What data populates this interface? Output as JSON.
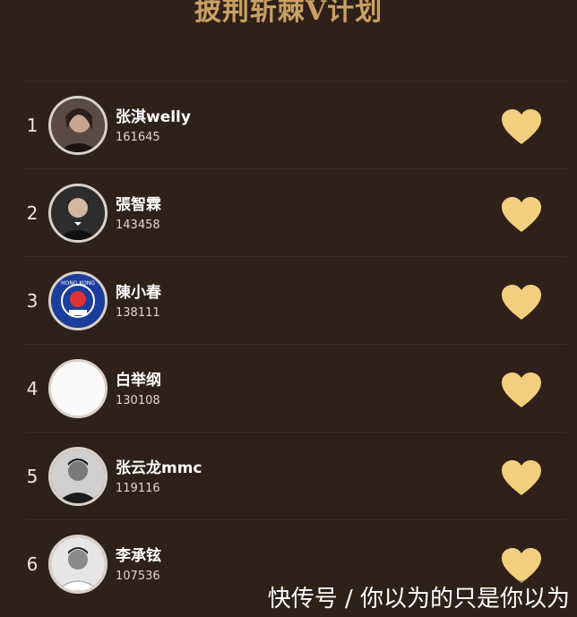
{
  "header": {
    "title": "披荆斩棘V计划"
  },
  "ranking": [
    {
      "rank": "1",
      "name": "张淇welly",
      "score": "161645"
    },
    {
      "rank": "2",
      "name": "張智霖",
      "score": "143458"
    },
    {
      "rank": "3",
      "name": "陳小春",
      "score": "138111"
    },
    {
      "rank": "4",
      "name": "白举纲",
      "score": "130108"
    },
    {
      "rank": "5",
      "name": "张云龙mmc",
      "score": "119116"
    },
    {
      "rank": "6",
      "name": "李承铉",
      "score": "107536"
    }
  ],
  "watermark": "快传号 / 你以为的只是你以为",
  "colors": {
    "background": "#2f2019",
    "title": "#c9a063",
    "heart": "#f2cf7e"
  }
}
